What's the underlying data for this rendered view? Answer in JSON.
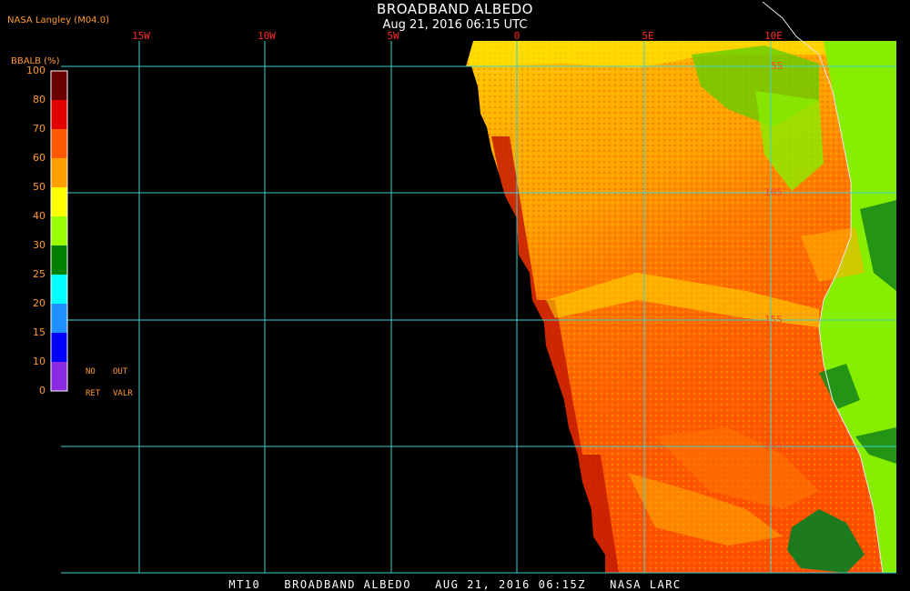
{
  "header": {
    "title": "BROADBAND ALBEDO",
    "subtitle": "Aug 21, 2016 06:15 UTC",
    "source": "NASA Langley (M04.0)"
  },
  "colorbar": {
    "title": "BBALB (%)",
    "ticks": [
      "100",
      "80",
      "70",
      "60",
      "50",
      "40",
      "30",
      "25",
      "20",
      "15",
      "10",
      "0"
    ],
    "colors": [
      "#6a0000",
      "#e00000",
      "#ff5a00",
      "#ffa000",
      "#ffff00",
      "#99ff00",
      "#008000",
      "#00ffff",
      "#1e90ff",
      "#0000ff",
      "#8a2be2"
    ],
    "no_label": "NO",
    "out_label": "OUT",
    "ret_label": "RET",
    "valr_label": "VALR"
  },
  "map": {
    "lon_labels": [
      "15W",
      "10W",
      "5W",
      "0",
      "5E",
      "10E"
    ],
    "lat_labels": [
      "5S",
      "10S",
      "15S",
      "20S"
    ]
  },
  "footer": {
    "text": "MT10   BROADBAND ALBEDO   AUG 21, 2016 06:15Z   NASA LARC"
  }
}
